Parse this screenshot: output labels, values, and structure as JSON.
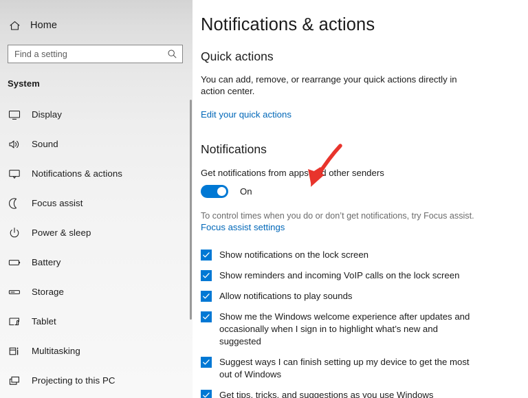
{
  "sidebar": {
    "home": {
      "label": "Home",
      "icon": "home-icon"
    },
    "search": {
      "placeholder": "Find a setting",
      "value": "",
      "icon": "search-icon"
    },
    "section_title": "System",
    "items": [
      {
        "label": "Display",
        "icon": "monitor-icon"
      },
      {
        "label": "Sound",
        "icon": "speaker-icon"
      },
      {
        "label": "Notifications & actions",
        "icon": "notification-icon"
      },
      {
        "label": "Focus assist",
        "icon": "moon-icon"
      },
      {
        "label": "Power & sleep",
        "icon": "power-icon"
      },
      {
        "label": "Battery",
        "icon": "battery-icon"
      },
      {
        "label": "Storage",
        "icon": "storage-icon"
      },
      {
        "label": "Tablet",
        "icon": "tablet-icon"
      },
      {
        "label": "Multitasking",
        "icon": "multitasking-icon"
      },
      {
        "label": "Projecting to this PC",
        "icon": "projecting-icon"
      }
    ]
  },
  "main": {
    "page_title": "Notifications & actions",
    "quick_actions": {
      "heading": "Quick actions",
      "description": "You can add, remove, or rearrange your quick actions directly in action center.",
      "link": "Edit your quick actions"
    },
    "notifications": {
      "heading": "Notifications",
      "toggle_caption": "Get notifications from apps and other senders",
      "toggle_state": "On",
      "focus_note": "To control times when you do or don’t get notifications, try Focus assist.",
      "focus_link": "Focus assist settings",
      "checkboxes": [
        {
          "label": "Show notifications on the lock screen",
          "checked": true
        },
        {
          "label": "Show reminders and incoming VoIP calls on the lock screen",
          "checked": true
        },
        {
          "label": "Allow notifications to play sounds",
          "checked": true
        },
        {
          "label": "Show me the Windows welcome experience after updates and occasionally when I sign in to highlight what’s new and suggested",
          "checked": true
        },
        {
          "label": "Suggest ways I can finish setting up my device to get the most out of Windows",
          "checked": true
        },
        {
          "label": "Get tips, tricks, and suggestions as you use Windows",
          "checked": true
        }
      ]
    }
  },
  "annotation": {
    "type": "arrow",
    "color": "#e8342c",
    "points_to": "Get notifications from apps and other senders"
  },
  "colors": {
    "accent": "#0078d4",
    "link": "#0067b8",
    "annotation_red": "#e8342c",
    "text": "#1b1b1b",
    "muted_text": "#6b6b6b"
  }
}
